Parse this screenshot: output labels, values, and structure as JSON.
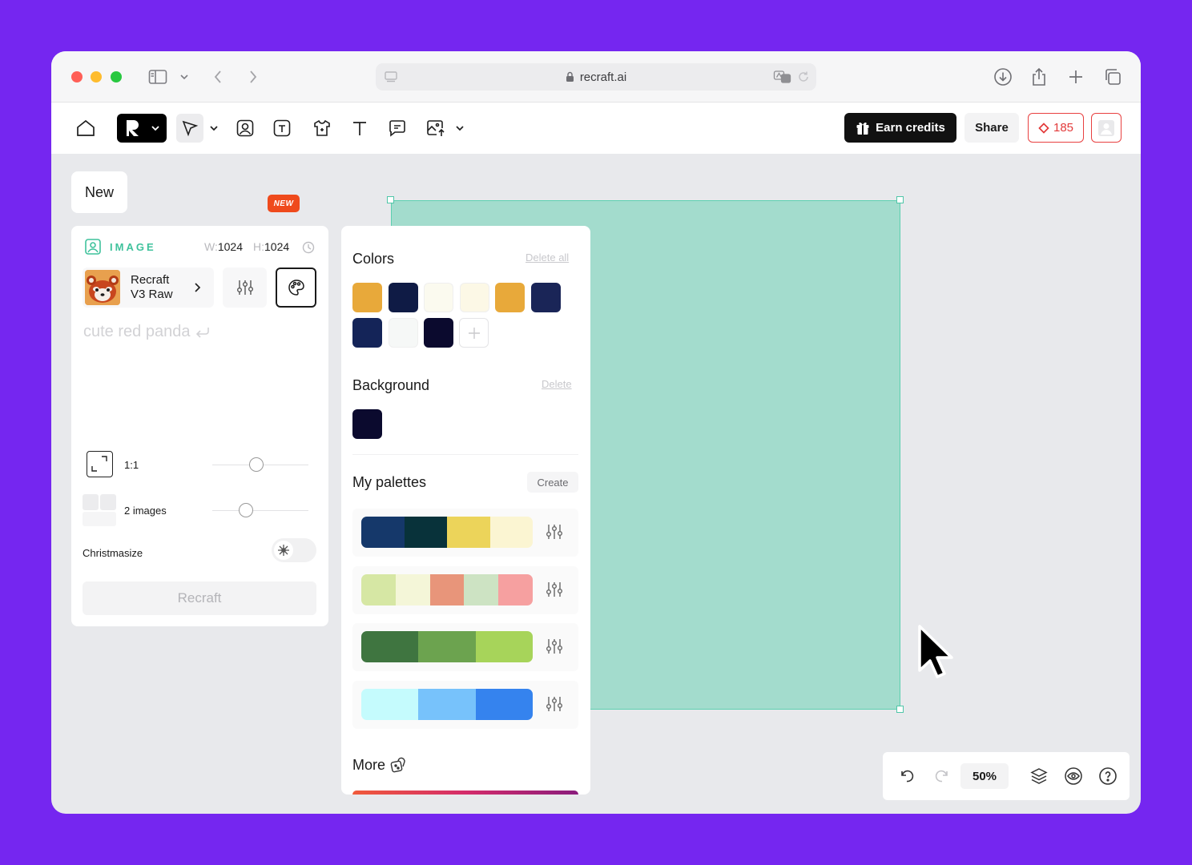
{
  "browser": {
    "url": "recraft.ai"
  },
  "toolbar": {
    "new_badge": "NEW",
    "earn_credits": "Earn credits",
    "share": "Share",
    "credits": "185"
  },
  "tab": {
    "label": "New"
  },
  "left_panel": {
    "type_label": "IMAGE",
    "width_label": "W:",
    "width_value": "1024",
    "height_label": "H:",
    "height_value": "1024",
    "model_name_line1": "Recraft",
    "model_name_line2": "V3 Raw",
    "prompt": "cute red panda",
    "aspect_ratio": "1:1",
    "image_count": "2 images",
    "christmasize_label": "Christmasize",
    "recraft_button": "Recraft"
  },
  "colors_panel": {
    "colors_title": "Colors",
    "delete_all": "Delete all",
    "colors": [
      "#e8a93a",
      "#0f1b45",
      "#fbfaef",
      "#fcf8e6",
      "#e8a93a",
      "#1a2557",
      "#142458",
      "#f6f8f7",
      "#0b0a2e"
    ],
    "background_title": "Background",
    "background_delete": "Delete",
    "background_color": "#0b0a2e",
    "palettes_title": "My palettes",
    "create_label": "Create",
    "palettes": [
      [
        "#15386a",
        "#08323a",
        "#ecd45a",
        "#fbf5d2"
      ],
      [
        "#d6e7a4",
        "#f4f6d8",
        "#e8957a",
        "#cde3c3",
        "#f6a0a0"
      ],
      [
        "#3f7540",
        "#6ca34f",
        "#a7d45a"
      ],
      [
        "#c5fbfd",
        "#77c2fb",
        "#3583ee"
      ]
    ],
    "more_title": "More"
  },
  "canvas": {
    "frame_color": "#a3dccd"
  },
  "bottom_bar": {
    "zoom": "50%"
  }
}
